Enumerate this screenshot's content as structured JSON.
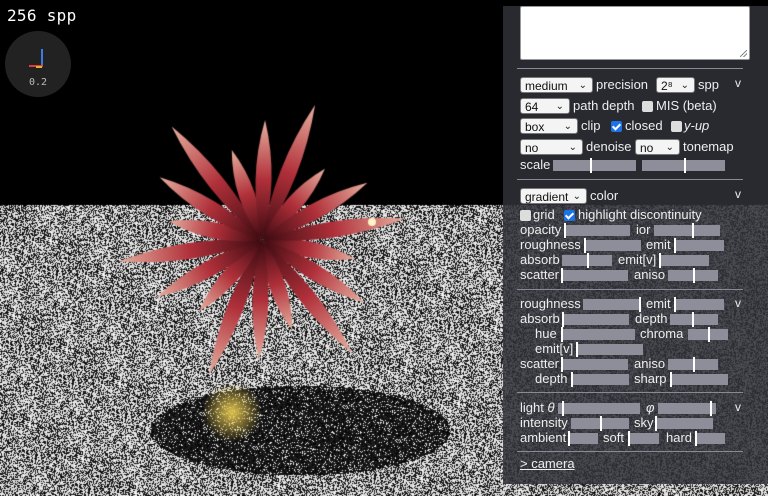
{
  "viewport": {
    "spp_label": "256 spp",
    "zoom": "0.2"
  },
  "render": {
    "precision": {
      "value": "medium",
      "label": "precision"
    },
    "spp": {
      "value": "2⁸",
      "label": "spp"
    },
    "path_depth": {
      "value": "64",
      "label": "path depth"
    },
    "mis": {
      "label": "MIS (beta)",
      "checked": false
    },
    "clip": {
      "value": "box",
      "label": "clip"
    },
    "closed": {
      "label": "closed",
      "checked": true
    },
    "y_up": {
      "label": "y-up",
      "checked": false
    },
    "denoise": {
      "value": "no",
      "label": "denoise"
    },
    "tonemap": {
      "value": "no",
      "label": "tonemap"
    },
    "scale": {
      "label": "scale",
      "levels": [
        0.45,
        0.5
      ]
    },
    "toggle": "v"
  },
  "surface": {
    "color": {
      "value": "gradient",
      "label": "color"
    },
    "grid": {
      "label": "grid",
      "checked": false
    },
    "highlight": {
      "label": "highlight discontinuity",
      "checked": true
    },
    "opacity": {
      "label": "opacity",
      "level": 0.0
    },
    "ior": {
      "label": "ior",
      "level": 0.58
    },
    "roughness": {
      "label": "roughness",
      "level": 0.0
    },
    "emit": {
      "label": "emit",
      "level": 0.0
    },
    "absorb": {
      "label": "absorb",
      "level": 0.5
    },
    "emitv": {
      "label": "emit[v]",
      "level": 0.0
    },
    "scatter": {
      "label": "scatter",
      "level": 0.0
    },
    "aniso": {
      "label": "aniso",
      "level": 0.5
    },
    "toggle": "v"
  },
  "volume": {
    "roughness": {
      "label": "roughness",
      "level": 1.0
    },
    "emit": {
      "label": "emit",
      "level": 0.0
    },
    "absorb": {
      "label": "absorb",
      "level": 0.0
    },
    "depth": {
      "label": "depth",
      "level": 0.45
    },
    "hue": {
      "label": "hue",
      "level": 0.0
    },
    "chroma": {
      "label": "chroma",
      "level": 0.5
    },
    "emitv": {
      "label": "emit[v]",
      "level": 0.0
    },
    "scatter": {
      "label": "scatter",
      "level": 0.0
    },
    "aniso": {
      "label": "aniso",
      "level": 0.5
    },
    "depth2": {
      "label": "depth",
      "level": 0.0
    },
    "sharp": {
      "label": "sharp",
      "level": 0.0
    },
    "toggle": "v"
  },
  "light": {
    "theta": {
      "label": "light",
      "symbol": "θ",
      "level": 0.05
    },
    "phi": {
      "label": "φ",
      "level": 0.9
    },
    "intensity": {
      "label": "intensity",
      "level": 0.5
    },
    "sky": {
      "label": "sky",
      "level": 0.0
    },
    "ambient": {
      "label": "ambient",
      "level": 0.0
    },
    "soft": {
      "label": "soft",
      "level": 0.0
    },
    "hard": {
      "label": "hard",
      "level": 0.0
    },
    "toggle": "v"
  },
  "camera_link": "> camera"
}
